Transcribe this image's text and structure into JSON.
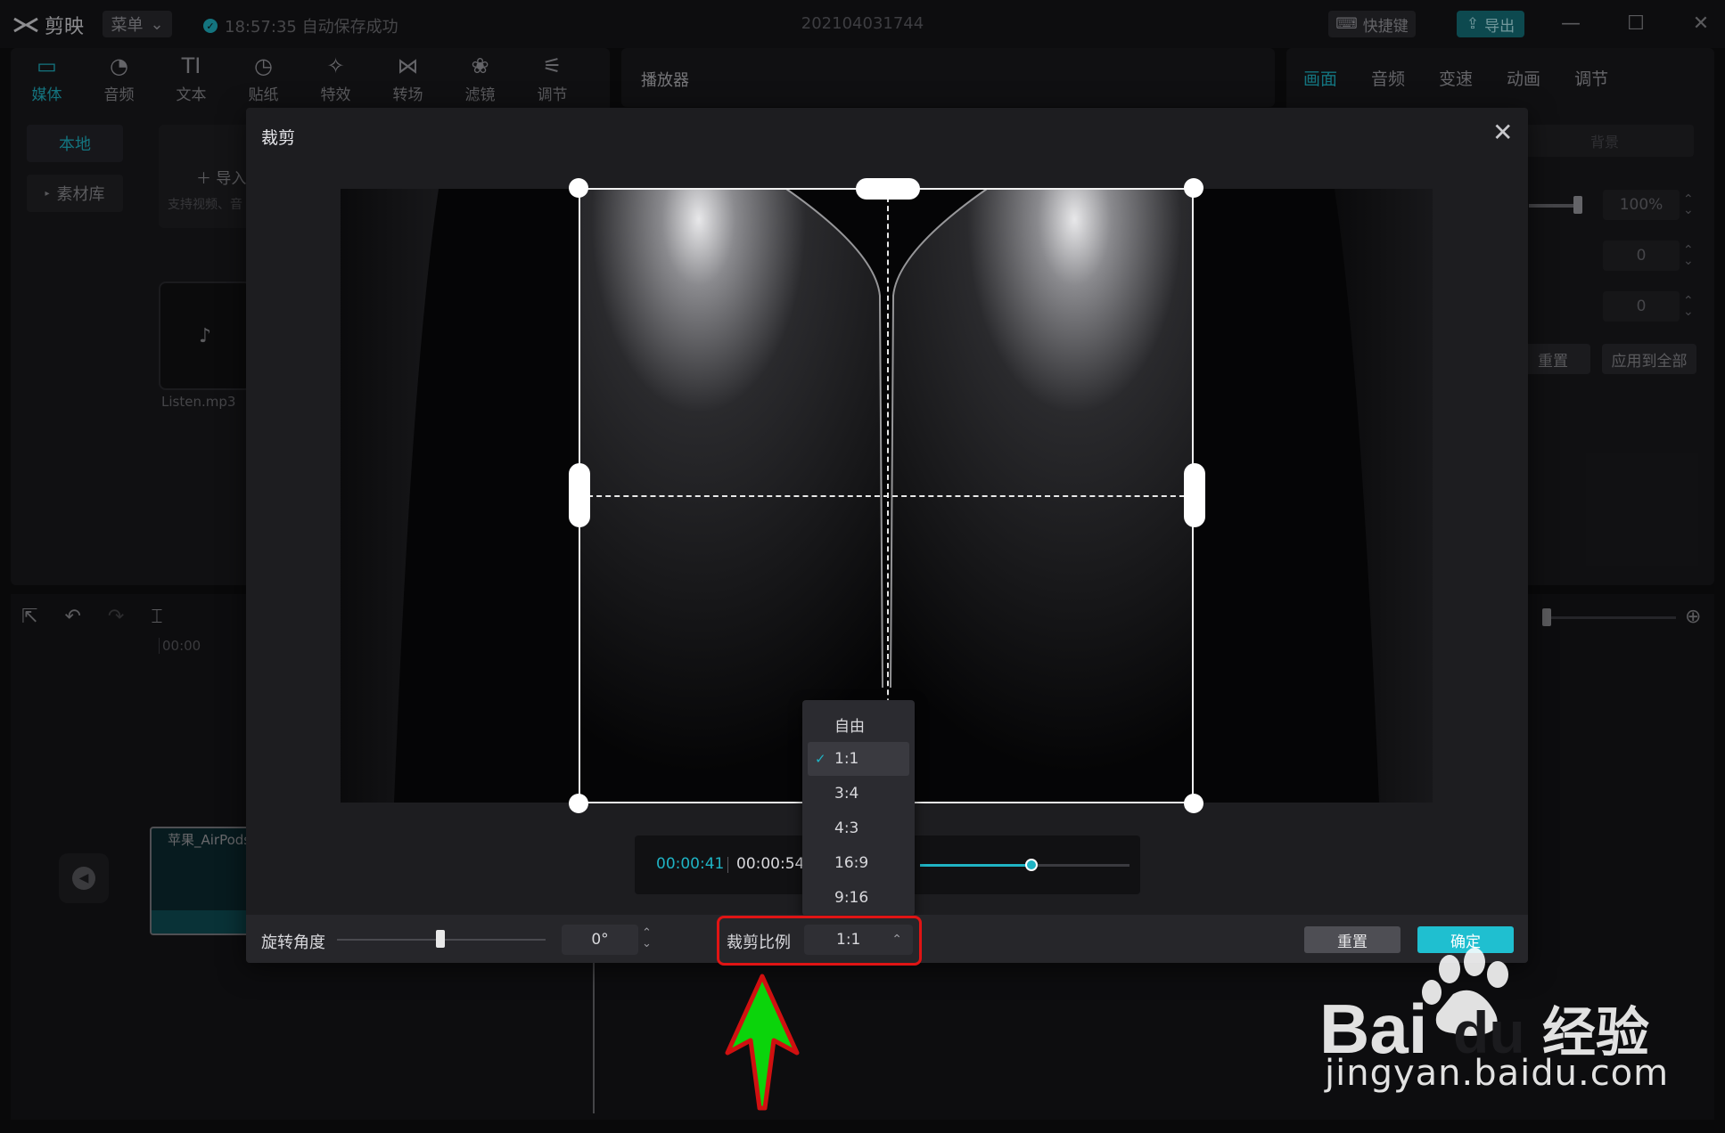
{
  "app": {
    "logo_text": "剪映",
    "menu_label": "菜单",
    "autosave_text": "18:57:35 自动保存成功",
    "project_name": "202104031744",
    "shortcut_label": "快捷键",
    "export_label": "导出"
  },
  "tool_tabs": [
    {
      "label": "媒体",
      "icon": "media-icon",
      "active": true
    },
    {
      "label": "音频",
      "icon": "audio-icon"
    },
    {
      "label": "文本",
      "icon": "text-icon"
    },
    {
      "label": "贴纸",
      "icon": "sticker-icon"
    },
    {
      "label": "特效",
      "icon": "effects-icon"
    },
    {
      "label": "转场",
      "icon": "transition-icon"
    },
    {
      "label": "滤镜",
      "icon": "filter-icon"
    },
    {
      "label": "调节",
      "icon": "adjust-icon"
    }
  ],
  "media_panel": {
    "local_label": "本地",
    "library_label": "素材库",
    "import_label": "导入",
    "import_hint": "支持视频、音",
    "file_name": "Listen.mp3"
  },
  "player": {
    "title": "播放器"
  },
  "right_panel": {
    "tabs": [
      "画面",
      "音频",
      "变速",
      "动画",
      "调节"
    ],
    "active_tab": "画面",
    "background_label": "背景",
    "scale_value": "100%",
    "pos_x_value": "0",
    "pos_y_value": "0",
    "reset_label": "重置",
    "apply_all_label": "应用到全部"
  },
  "timeline": {
    "start_time": "00:00",
    "clip_name": "苹果_AirPods"
  },
  "crop_dialog": {
    "title": "裁剪",
    "current_time": "00:00:41",
    "total_time": "00:00:54",
    "playback_progress": 0.48,
    "ratio_options": [
      "自由",
      "1:1",
      "3:4",
      "4:3",
      "16:9",
      "9:16"
    ],
    "selected_ratio": "1:1",
    "rotation_label": "旋转角度",
    "rotation_value": "0°",
    "ratio_label": "裁剪比例",
    "reset_label": "重置",
    "confirm_label": "确定"
  },
  "colors": {
    "accent": "#1fb3c4",
    "highlight_box": "#e01414",
    "arrow": "#0bd40b"
  },
  "watermark": {
    "brand": "Bai",
    "brand_suffix": "经验",
    "url": "jingyan.baidu.com"
  }
}
